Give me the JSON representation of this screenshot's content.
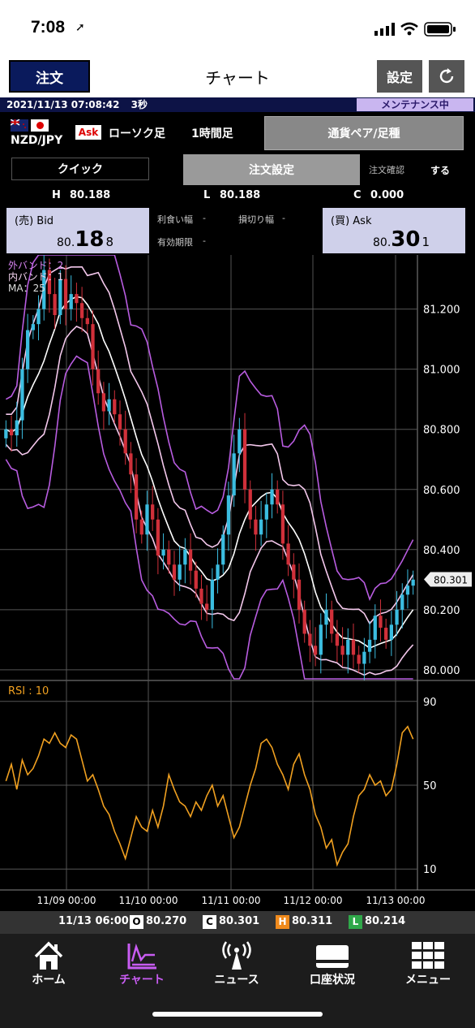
{
  "status": {
    "time": "7:08"
  },
  "header": {
    "order_button": "注文",
    "title": "チャート",
    "settings_button": "設定"
  },
  "info_bar": {
    "datetime": "2021/11/13 07:08:42",
    "interval": "3秒",
    "maintenance": "メンテナンス中"
  },
  "pair_row": {
    "pair": "NZD/JPY",
    "side_badge": "Ask",
    "candle_type": "ローソク足",
    "timeframe": "1時間足",
    "pair_select": "通貨ペア/足種"
  },
  "tabs": {
    "quick": "クイック",
    "order_settings": "注文設定",
    "order_confirm_label": "注文確認",
    "order_confirm_value": "する"
  },
  "hlc": {
    "h_label": "H",
    "h_value": "80.188",
    "l_label": "L",
    "l_value": "80.188",
    "c_label": "C",
    "c_value": "0.000"
  },
  "bid": {
    "label": "(売) Bid",
    "prefix": "80.",
    "big": "18",
    "sub": "8"
  },
  "ask": {
    "label": "(買) Ask",
    "prefix": "80.",
    "big": "30",
    "sub": "1"
  },
  "order_params": {
    "take_profit_label": "利食い幅",
    "take_profit_value": "-",
    "stop_loss_label": "損切り幅",
    "stop_loss_value": "-",
    "expiry_label": "有効期限",
    "expiry_value": "-"
  },
  "chart_data": [
    {
      "type": "candlestick",
      "legend": [
        "外バンド：2",
        "内バンド：1",
        "MA：25"
      ],
      "y_ticks": [
        "81.200",
        "81.000",
        "80.800",
        "80.600",
        "80.400",
        "80.200",
        "80.000"
      ],
      "ylim": [
        79.97,
        81.38
      ],
      "current_price": "80.301",
      "x_ticks": [
        "11/09 00:00",
        "11/10 00:00",
        "11/11 00:00",
        "11/12 00:00",
        "11/13 00:00"
      ],
      "series_colors": {
        "up": "#3bbde0",
        "down": "#d0303a",
        "outer_band": "#b85ce0",
        "inner_band": "#f4c8ec",
        "ma": "#ffffff"
      },
      "close": [
        80.8,
        80.78,
        80.83,
        81.0,
        81.13,
        81.15,
        81.2,
        81.33,
        81.25,
        81.18,
        81.3,
        81.2,
        81.25,
        81.22,
        81.17,
        81.15,
        81.0,
        80.92,
        80.86,
        80.9,
        80.85,
        80.8,
        80.72,
        80.65,
        80.5,
        80.45,
        80.55,
        80.5,
        80.38,
        80.4,
        80.35,
        80.3,
        80.35,
        80.4,
        80.33,
        80.27,
        80.22,
        80.2,
        80.3,
        80.35,
        80.45,
        80.58,
        80.72,
        80.8,
        80.6,
        80.5,
        80.45,
        80.5,
        80.55,
        80.6,
        80.55,
        80.42,
        80.35,
        80.3,
        80.2,
        80.12,
        80.08,
        80.05,
        80.15,
        80.2,
        80.12,
        80.08,
        80.05,
        80.1,
        80.05,
        80.02,
        80.06,
        80.1,
        80.18,
        80.14,
        80.1,
        80.15,
        80.2,
        80.25,
        80.28,
        80.3
      ]
    },
    {
      "type": "line",
      "title": "RSI : 10",
      "y_ticks": [
        "90",
        "50",
        "10"
      ],
      "ylim": [
        0,
        100
      ],
      "series": [
        {
          "values": [
            52,
            60,
            48,
            62,
            55,
            58,
            64,
            72,
            70,
            75,
            70,
            68,
            74,
            72,
            62,
            52,
            55,
            48,
            40,
            36,
            28,
            22,
            15,
            25,
            35,
            30,
            28,
            38,
            30,
            40,
            55,
            48,
            42,
            40,
            35,
            42,
            38,
            45,
            50,
            40,
            45,
            35,
            25,
            30,
            40,
            50,
            58,
            70,
            72,
            68,
            60,
            55,
            48,
            60,
            65,
            55,
            48,
            36,
            30,
            20,
            24,
            12,
            18,
            22,
            35,
            45,
            48,
            55,
            50,
            52,
            45,
            48,
            60,
            75,
            78,
            72
          ]
        }
      ]
    }
  ],
  "bottom_bar": {
    "time": "11/13 06:00",
    "o_label": "O",
    "o_value": "80.270",
    "c_label": "C",
    "c_value": "80.301",
    "h_label": "H",
    "h_value": "80.311",
    "l_label": "L",
    "l_value": "80.214"
  },
  "tab_bar": {
    "home": "ホーム",
    "chart": "チャート",
    "news": "ニュース",
    "account": "口座状況",
    "menu": "メニュー"
  }
}
